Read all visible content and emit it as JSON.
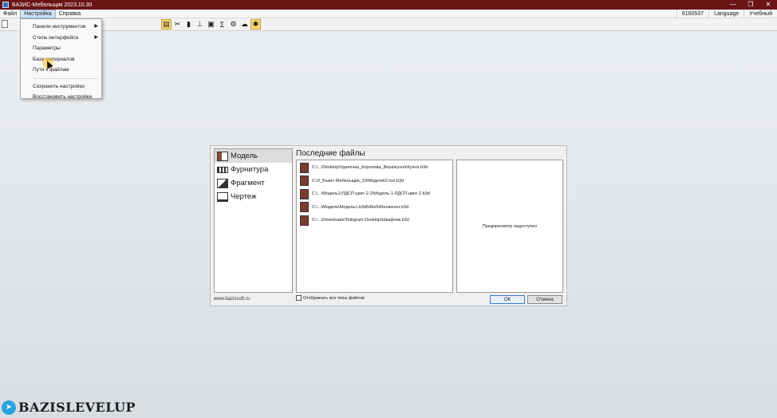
{
  "window": {
    "title": "БАЗИС-Мебельщик 2023.10.30",
    "controls": [
      "—",
      "❐",
      "✕"
    ]
  },
  "menubar": {
    "items": [
      "Файл",
      "Настройка",
      "Справка"
    ],
    "right": [
      "6160537",
      "Language",
      "Учебный"
    ]
  },
  "dropdown": {
    "items": [
      {
        "label": "Панели инструментов",
        "submenu": true
      },
      {
        "label": "Стиль интерфейса",
        "submenu": true
      },
      {
        "label": "Параметры",
        "submenu": false
      },
      {
        "label": "База материалов",
        "submenu": false
      },
      {
        "label": "Пути к файлам",
        "submenu": false
      },
      {
        "label": "Сохранить настройки",
        "submenu": false
      },
      {
        "label": "Восстановить настройки",
        "submenu": false
      }
    ]
  },
  "dialog": {
    "categories": [
      "Модель",
      "Фурнитура",
      "Фрагмент",
      "Чертеж"
    ],
    "recent_title": "Последние файлы",
    "recent_files": [
      "C:\\...\\Desktop\\Удаленка_Королева_Вера\\кухня\\Кухня.b3d",
      "C:\\#_Базис-Мебельщик_10\\Модели\\Стол.b3d",
      "C:\\...\\Модель1\\ЛДСП-цвет-2-2\\Модель-1-ЛДСП-цвет-2.b3d",
      "C:\\...\\Модели\\Модель1.b3d546e546енкенен.b3d",
      "C:\\...\\Downloads\\Telegram Desktop\\Шкафчик.b3d"
    ],
    "preview_text": "Предпросмотр недоступен",
    "site": "www.bazissoft.ru",
    "show_all_label": "Отображать все типы файлов",
    "ok_label": "ОК",
    "cancel_label": "Отмена"
  },
  "watermark": {
    "text": "BAZISLEVELUP"
  },
  "colors": {
    "titlebar": "#6b1414",
    "menu_highlight": "#cfe2f6",
    "toolbar_highlight": "#f7d774",
    "telegram": "#2aa3dc"
  }
}
